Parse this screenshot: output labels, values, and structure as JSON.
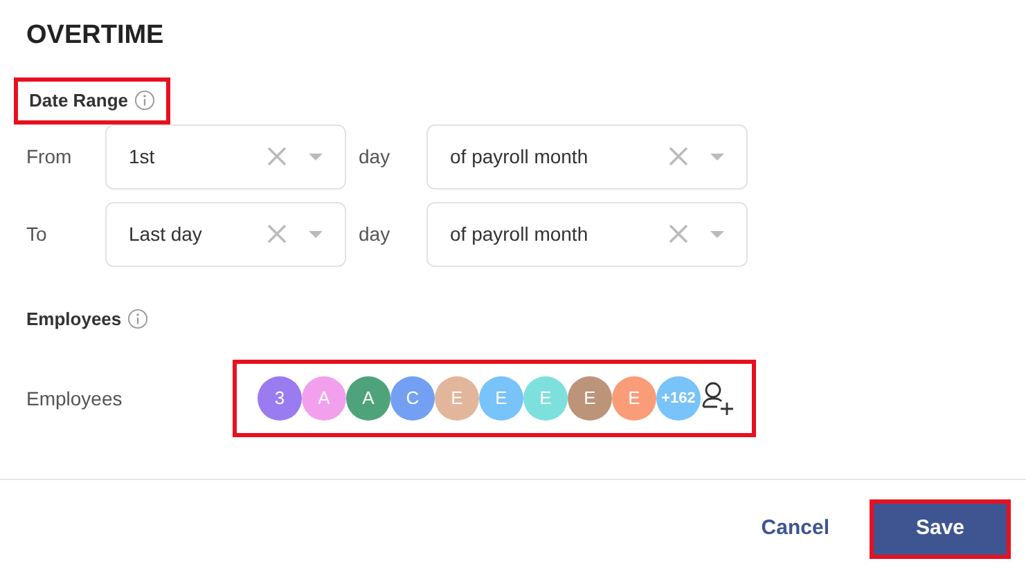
{
  "title": "OVERTIME",
  "date_range": {
    "label": "Date Range",
    "highlighted": true,
    "rows": [
      {
        "label": "From",
        "value": "1st",
        "unit": "day",
        "period": "of payroll month"
      },
      {
        "label": "To",
        "value": "Last day",
        "unit": "day",
        "period": "of payroll month"
      }
    ]
  },
  "employees_section": {
    "label": "Employees"
  },
  "employees_field": {
    "label": "Employees",
    "highlighted": true,
    "avatars": [
      {
        "initial": "3",
        "color": "#9b7bf0"
      },
      {
        "initial": "A",
        "color": "#f2a0ee"
      },
      {
        "initial": "A",
        "color": "#4fa37a"
      },
      {
        "initial": "C",
        "color": "#74a0f4"
      },
      {
        "initial": "E",
        "color": "#e2b69a"
      },
      {
        "initial": "E",
        "color": "#77c3fa"
      },
      {
        "initial": "E",
        "color": "#7ee0dd"
      },
      {
        "initial": "E",
        "color": "#bc9479"
      },
      {
        "initial": "E",
        "color": "#fb9c79"
      },
      {
        "initial": "+162",
        "color": "#77c3fa"
      }
    ]
  },
  "buttons": [
    {
      "label": "Cancel",
      "kind": "link",
      "highlighted": false
    },
    {
      "label": "Save",
      "kind": "primary",
      "highlighted": true
    }
  ]
}
